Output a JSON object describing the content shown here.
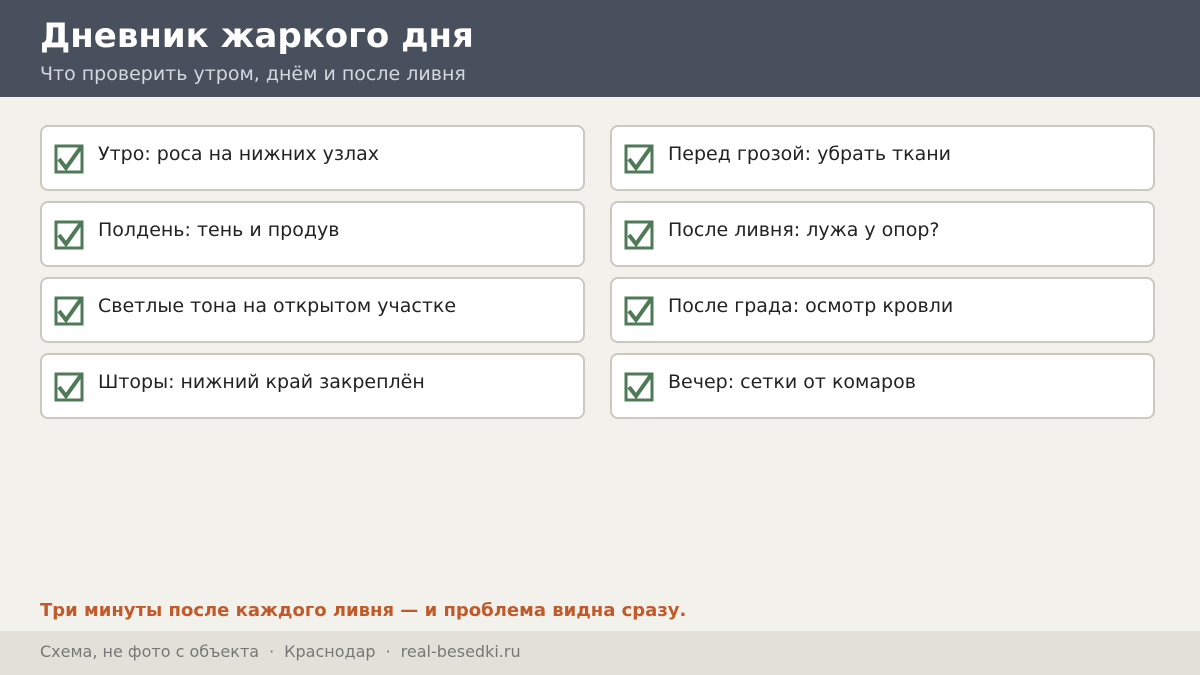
{
  "header": {
    "title": "Дневник жаркого дня",
    "subtitle": "Что проверить утром, днём и после ливня"
  },
  "checklist": {
    "left": [
      {
        "label": "Утро: роса на нижних узлах",
        "checked": true
      },
      {
        "label": "Полдень: тень и продув",
        "checked": true
      },
      {
        "label": "Светлые тона на открытом участке",
        "checked": true
      },
      {
        "label": "Шторы: нижний край закреплён",
        "checked": true
      }
    ],
    "right": [
      {
        "label": "Перед грозой: убрать ткани",
        "checked": true
      },
      {
        "label": "После ливня: лужа у опор?",
        "checked": true
      },
      {
        "label": "После града: осмотр кровли",
        "checked": true
      },
      {
        "label": "Вечер: сетки от комаров",
        "checked": true
      }
    ]
  },
  "tagline": "Три минуты после каждого ливня — и проблема видна сразу.",
  "footer": {
    "note": "Схема, не фото с объекта",
    "city": "Краснодар",
    "site": "real-besedki.ru",
    "separator": "·"
  },
  "colors": {
    "header_bg": "#47505c",
    "check_green": "#4f7a57",
    "accent": "#c05a2a"
  },
  "icons": {
    "checkbox": "checkbox-checked-icon"
  }
}
